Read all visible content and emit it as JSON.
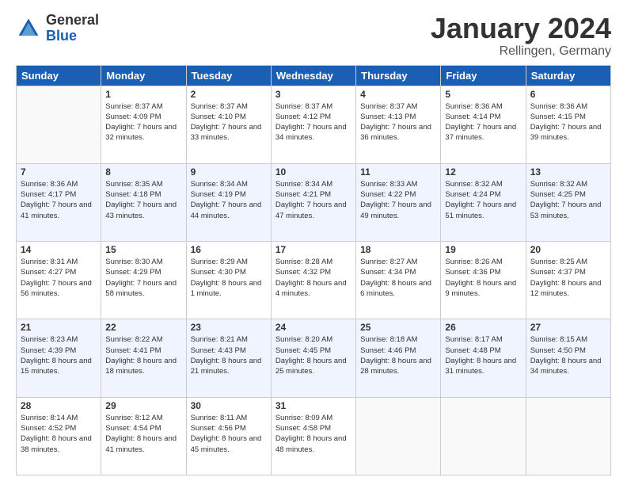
{
  "logo": {
    "general": "General",
    "blue": "Blue"
  },
  "header": {
    "title": "January 2024",
    "subtitle": "Rellingen, Germany"
  },
  "weekdays": [
    "Sunday",
    "Monday",
    "Tuesday",
    "Wednesday",
    "Thursday",
    "Friday",
    "Saturday"
  ],
  "weeks": [
    [
      {
        "day": "",
        "sunrise": "",
        "sunset": "",
        "daylight": ""
      },
      {
        "day": "1",
        "sunrise": "Sunrise: 8:37 AM",
        "sunset": "Sunset: 4:09 PM",
        "daylight": "Daylight: 7 hours and 32 minutes."
      },
      {
        "day": "2",
        "sunrise": "Sunrise: 8:37 AM",
        "sunset": "Sunset: 4:10 PM",
        "daylight": "Daylight: 7 hours and 33 minutes."
      },
      {
        "day": "3",
        "sunrise": "Sunrise: 8:37 AM",
        "sunset": "Sunset: 4:12 PM",
        "daylight": "Daylight: 7 hours and 34 minutes."
      },
      {
        "day": "4",
        "sunrise": "Sunrise: 8:37 AM",
        "sunset": "Sunset: 4:13 PM",
        "daylight": "Daylight: 7 hours and 36 minutes."
      },
      {
        "day": "5",
        "sunrise": "Sunrise: 8:36 AM",
        "sunset": "Sunset: 4:14 PM",
        "daylight": "Daylight: 7 hours and 37 minutes."
      },
      {
        "day": "6",
        "sunrise": "Sunrise: 8:36 AM",
        "sunset": "Sunset: 4:15 PM",
        "daylight": "Daylight: 7 hours and 39 minutes."
      }
    ],
    [
      {
        "day": "7",
        "sunrise": "Sunrise: 8:36 AM",
        "sunset": "Sunset: 4:17 PM",
        "daylight": "Daylight: 7 hours and 41 minutes."
      },
      {
        "day": "8",
        "sunrise": "Sunrise: 8:35 AM",
        "sunset": "Sunset: 4:18 PM",
        "daylight": "Daylight: 7 hours and 43 minutes."
      },
      {
        "day": "9",
        "sunrise": "Sunrise: 8:34 AM",
        "sunset": "Sunset: 4:19 PM",
        "daylight": "Daylight: 7 hours and 44 minutes."
      },
      {
        "day": "10",
        "sunrise": "Sunrise: 8:34 AM",
        "sunset": "Sunset: 4:21 PM",
        "daylight": "Daylight: 7 hours and 47 minutes."
      },
      {
        "day": "11",
        "sunrise": "Sunrise: 8:33 AM",
        "sunset": "Sunset: 4:22 PM",
        "daylight": "Daylight: 7 hours and 49 minutes."
      },
      {
        "day": "12",
        "sunrise": "Sunrise: 8:32 AM",
        "sunset": "Sunset: 4:24 PM",
        "daylight": "Daylight: 7 hours and 51 minutes."
      },
      {
        "day": "13",
        "sunrise": "Sunrise: 8:32 AM",
        "sunset": "Sunset: 4:25 PM",
        "daylight": "Daylight: 7 hours and 53 minutes."
      }
    ],
    [
      {
        "day": "14",
        "sunrise": "Sunrise: 8:31 AM",
        "sunset": "Sunset: 4:27 PM",
        "daylight": "Daylight: 7 hours and 56 minutes."
      },
      {
        "day": "15",
        "sunrise": "Sunrise: 8:30 AM",
        "sunset": "Sunset: 4:29 PM",
        "daylight": "Daylight: 7 hours and 58 minutes."
      },
      {
        "day": "16",
        "sunrise": "Sunrise: 8:29 AM",
        "sunset": "Sunset: 4:30 PM",
        "daylight": "Daylight: 8 hours and 1 minute."
      },
      {
        "day": "17",
        "sunrise": "Sunrise: 8:28 AM",
        "sunset": "Sunset: 4:32 PM",
        "daylight": "Daylight: 8 hours and 4 minutes."
      },
      {
        "day": "18",
        "sunrise": "Sunrise: 8:27 AM",
        "sunset": "Sunset: 4:34 PM",
        "daylight": "Daylight: 8 hours and 6 minutes."
      },
      {
        "day": "19",
        "sunrise": "Sunrise: 8:26 AM",
        "sunset": "Sunset: 4:36 PM",
        "daylight": "Daylight: 8 hours and 9 minutes."
      },
      {
        "day": "20",
        "sunrise": "Sunrise: 8:25 AM",
        "sunset": "Sunset: 4:37 PM",
        "daylight": "Daylight: 8 hours and 12 minutes."
      }
    ],
    [
      {
        "day": "21",
        "sunrise": "Sunrise: 8:23 AM",
        "sunset": "Sunset: 4:39 PM",
        "daylight": "Daylight: 8 hours and 15 minutes."
      },
      {
        "day": "22",
        "sunrise": "Sunrise: 8:22 AM",
        "sunset": "Sunset: 4:41 PM",
        "daylight": "Daylight: 8 hours and 18 minutes."
      },
      {
        "day": "23",
        "sunrise": "Sunrise: 8:21 AM",
        "sunset": "Sunset: 4:43 PM",
        "daylight": "Daylight: 8 hours and 21 minutes."
      },
      {
        "day": "24",
        "sunrise": "Sunrise: 8:20 AM",
        "sunset": "Sunset: 4:45 PM",
        "daylight": "Daylight: 8 hours and 25 minutes."
      },
      {
        "day": "25",
        "sunrise": "Sunrise: 8:18 AM",
        "sunset": "Sunset: 4:46 PM",
        "daylight": "Daylight: 8 hours and 28 minutes."
      },
      {
        "day": "26",
        "sunrise": "Sunrise: 8:17 AM",
        "sunset": "Sunset: 4:48 PM",
        "daylight": "Daylight: 8 hours and 31 minutes."
      },
      {
        "day": "27",
        "sunrise": "Sunrise: 8:15 AM",
        "sunset": "Sunset: 4:50 PM",
        "daylight": "Daylight: 8 hours and 34 minutes."
      }
    ],
    [
      {
        "day": "28",
        "sunrise": "Sunrise: 8:14 AM",
        "sunset": "Sunset: 4:52 PM",
        "daylight": "Daylight: 8 hours and 38 minutes."
      },
      {
        "day": "29",
        "sunrise": "Sunrise: 8:12 AM",
        "sunset": "Sunset: 4:54 PM",
        "daylight": "Daylight: 8 hours and 41 minutes."
      },
      {
        "day": "30",
        "sunrise": "Sunrise: 8:11 AM",
        "sunset": "Sunset: 4:56 PM",
        "daylight": "Daylight: 8 hours and 45 minutes."
      },
      {
        "day": "31",
        "sunrise": "Sunrise: 8:09 AM",
        "sunset": "Sunset: 4:58 PM",
        "daylight": "Daylight: 8 hours and 48 minutes."
      },
      {
        "day": "",
        "sunrise": "",
        "sunset": "",
        "daylight": ""
      },
      {
        "day": "",
        "sunrise": "",
        "sunset": "",
        "daylight": ""
      },
      {
        "day": "",
        "sunrise": "",
        "sunset": "",
        "daylight": ""
      }
    ]
  ]
}
